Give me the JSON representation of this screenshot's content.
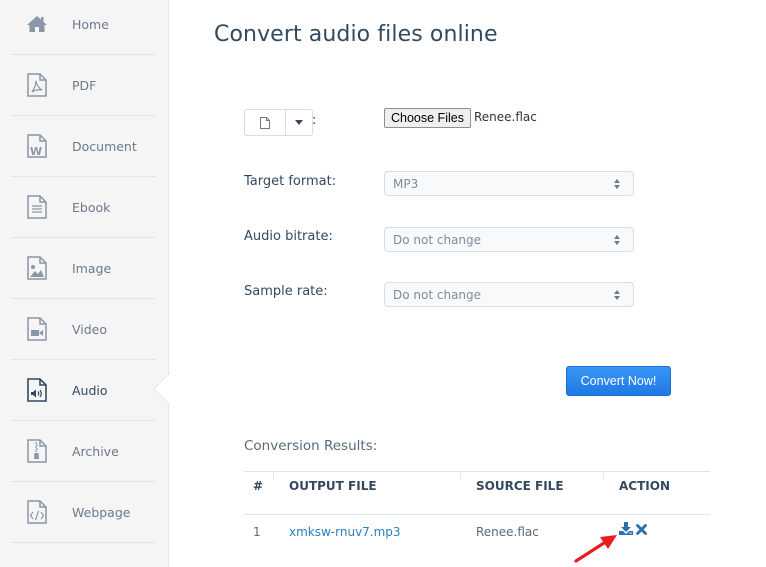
{
  "sidebar": {
    "items": [
      {
        "label": "Home",
        "icon": "home-icon"
      },
      {
        "label": "PDF",
        "icon": "pdf-file-icon"
      },
      {
        "label": "Document",
        "icon": "word-document-icon"
      },
      {
        "label": "Ebook",
        "icon": "ebook-file-icon"
      },
      {
        "label": "Image",
        "icon": "image-file-icon"
      },
      {
        "label": "Video",
        "icon": "video-file-icon"
      },
      {
        "label": "Audio",
        "icon": "audio-file-icon",
        "active": true
      },
      {
        "label": "Archive",
        "icon": "archive-file-icon"
      },
      {
        "label": "Webpage",
        "icon": "webpage-file-icon"
      }
    ]
  },
  "page": {
    "title": "Convert audio files online"
  },
  "source": {
    "colon": ":",
    "choose_label": "Choose Files",
    "chosen_file": "Renee.flac"
  },
  "options": {
    "target_format": {
      "label": "Target format:",
      "value": "MP3"
    },
    "audio_bitrate": {
      "label": "Audio bitrate:",
      "value": "Do not change"
    },
    "sample_rate": {
      "label": "Sample rate:",
      "value": "Do not change"
    }
  },
  "convert_button": "Convert Now!",
  "results": {
    "title": "Conversion Results:",
    "columns": [
      "#",
      "OUTPUT FILE",
      "SOURCE FILE",
      "ACTION"
    ],
    "rows": [
      {
        "index": "1",
        "output_file": "xmksw-rnuv7.mp3",
        "source_file": "Renee.flac",
        "actions": [
          "download-icon",
          "delete-icon"
        ]
      }
    ]
  },
  "colors": {
    "accent": "#1f78e6",
    "link": "#2a7fc1",
    "action_icon": "#2a6fb0",
    "annotation_arrow": "#e81e1e"
  }
}
